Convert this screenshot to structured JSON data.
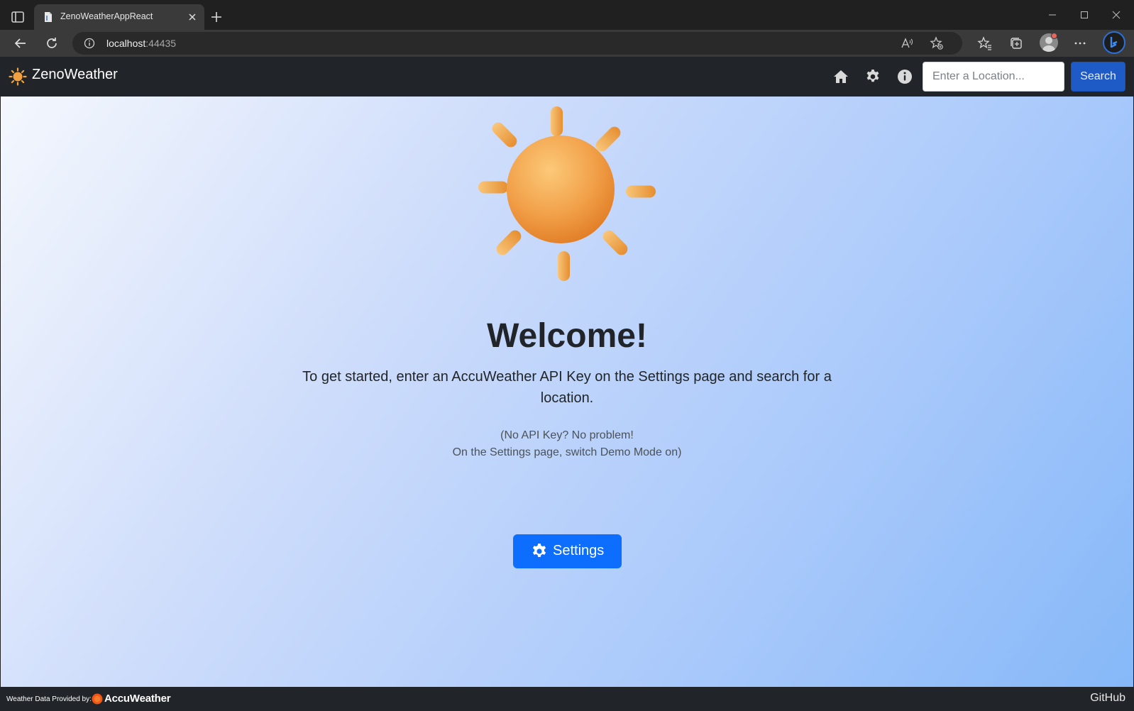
{
  "browser": {
    "tab_title": "ZenoWeatherAppReact",
    "url_host": "localhost",
    "url_port": ":44435",
    "icons": [
      "sidebar-icon",
      "favicon-icon",
      "close-icon",
      "plus-icon",
      "minimize-icon",
      "maximize-icon",
      "back-icon",
      "refresh-icon",
      "info-icon",
      "read-aloud-icon",
      "favorite-add-icon",
      "favorites-icon",
      "collections-icon",
      "profile-icon",
      "more-icon",
      "copilot-icon"
    ]
  },
  "nav": {
    "brand": "ZenoWeather",
    "search_placeholder": "Enter a Location...",
    "search_button": "Search",
    "icons": [
      "home-icon",
      "gear-icon",
      "info-icon"
    ]
  },
  "main": {
    "title": "Welcome!",
    "intro": "To get started, enter an AccuWeather API Key on the Settings page and search for a location.",
    "note_line1": "(No API Key? No problem!",
    "note_line2": "On the Settings page, switch Demo Mode on)",
    "settings_button": "Settings"
  },
  "footer": {
    "credit": "Weather Data Provided by:",
    "provider": "AccuWeather",
    "github": "GitHub"
  },
  "colors": {
    "navbar": "#212529",
    "primary": "#0d6efd",
    "search_button": "#1e5bc6",
    "sun": "#f0a040",
    "gradient_start": "#f4f7fd",
    "gradient_end": "#86b8f8"
  }
}
